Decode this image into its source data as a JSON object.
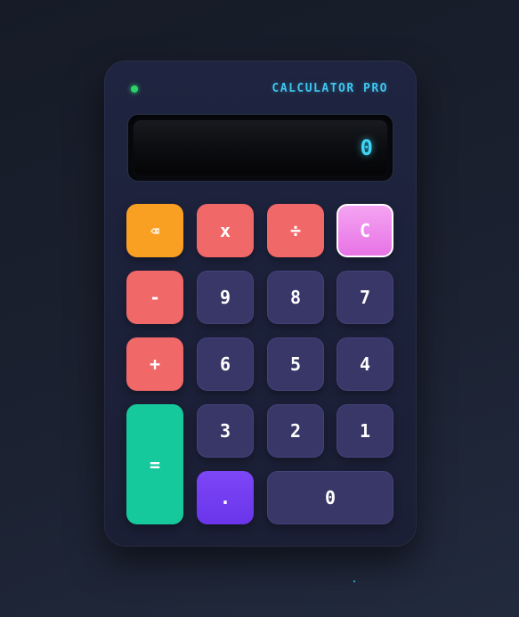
{
  "header": {
    "status_led_color": "#2bd46b",
    "title": "CALCULATOR PRO"
  },
  "display": {
    "value": "0"
  },
  "keys": {
    "backspace": "⌫",
    "multiply": "x",
    "divide": "÷",
    "clear": "C",
    "minus": "-",
    "nine": "9",
    "eight": "8",
    "seven": "7",
    "plus": "+",
    "six": "6",
    "five": "5",
    "four": "4",
    "equals": "=",
    "three": "3",
    "two": "2",
    "one": "1",
    "dot": ".",
    "zero": "0"
  },
  "colors": {
    "accent": "#3fc6f0",
    "number_key": "#383768",
    "operator_key": "#f06868",
    "backspace_key": "#f9a023",
    "clear_key": "#e873e6",
    "equals_key": "#16c99c",
    "dot_key": "#6a35ea"
  }
}
